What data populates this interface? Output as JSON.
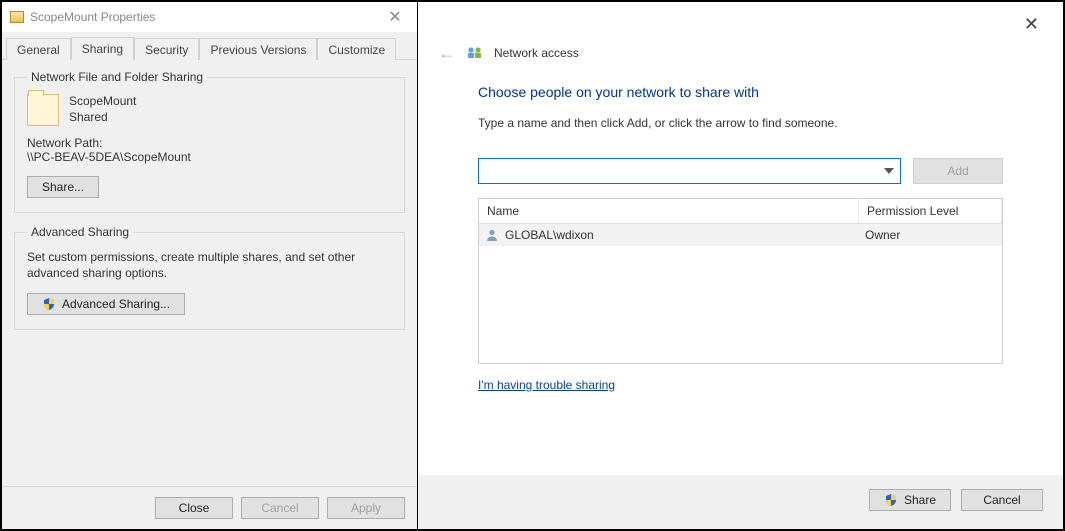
{
  "props": {
    "window_title": "ScopeMount Properties",
    "tabs": [
      "General",
      "Sharing",
      "Security",
      "Previous Versions",
      "Customize"
    ],
    "active_tab": 1,
    "group1": {
      "legend": "Network File and Folder Sharing",
      "share_name": "ScopeMount",
      "share_status": "Shared",
      "network_path_label": "Network Path:",
      "network_path": "\\\\PC-BEAV-5DEA\\ScopeMount",
      "share_button": "Share..."
    },
    "group2": {
      "legend": "Advanced Sharing",
      "desc": "Set custom permissions, create multiple shares, and set other advanced sharing options.",
      "button": "Advanced Sharing..."
    },
    "footer": {
      "close": "Close",
      "cancel": "Cancel",
      "apply": "Apply"
    }
  },
  "wizard": {
    "crumb": "Network access",
    "headline": "Choose people on your network to share with",
    "hint": "Type a name and then click Add, or click the arrow to find someone.",
    "combo_value": "",
    "add_button": "Add",
    "columns": {
      "name": "Name",
      "perm": "Permission Level"
    },
    "rows": [
      {
        "name": "GLOBAL\\wdixon",
        "perm": "Owner"
      }
    ],
    "trouble_link": "I'm having trouble sharing",
    "footer": {
      "share": "Share",
      "cancel": "Cancel"
    }
  }
}
